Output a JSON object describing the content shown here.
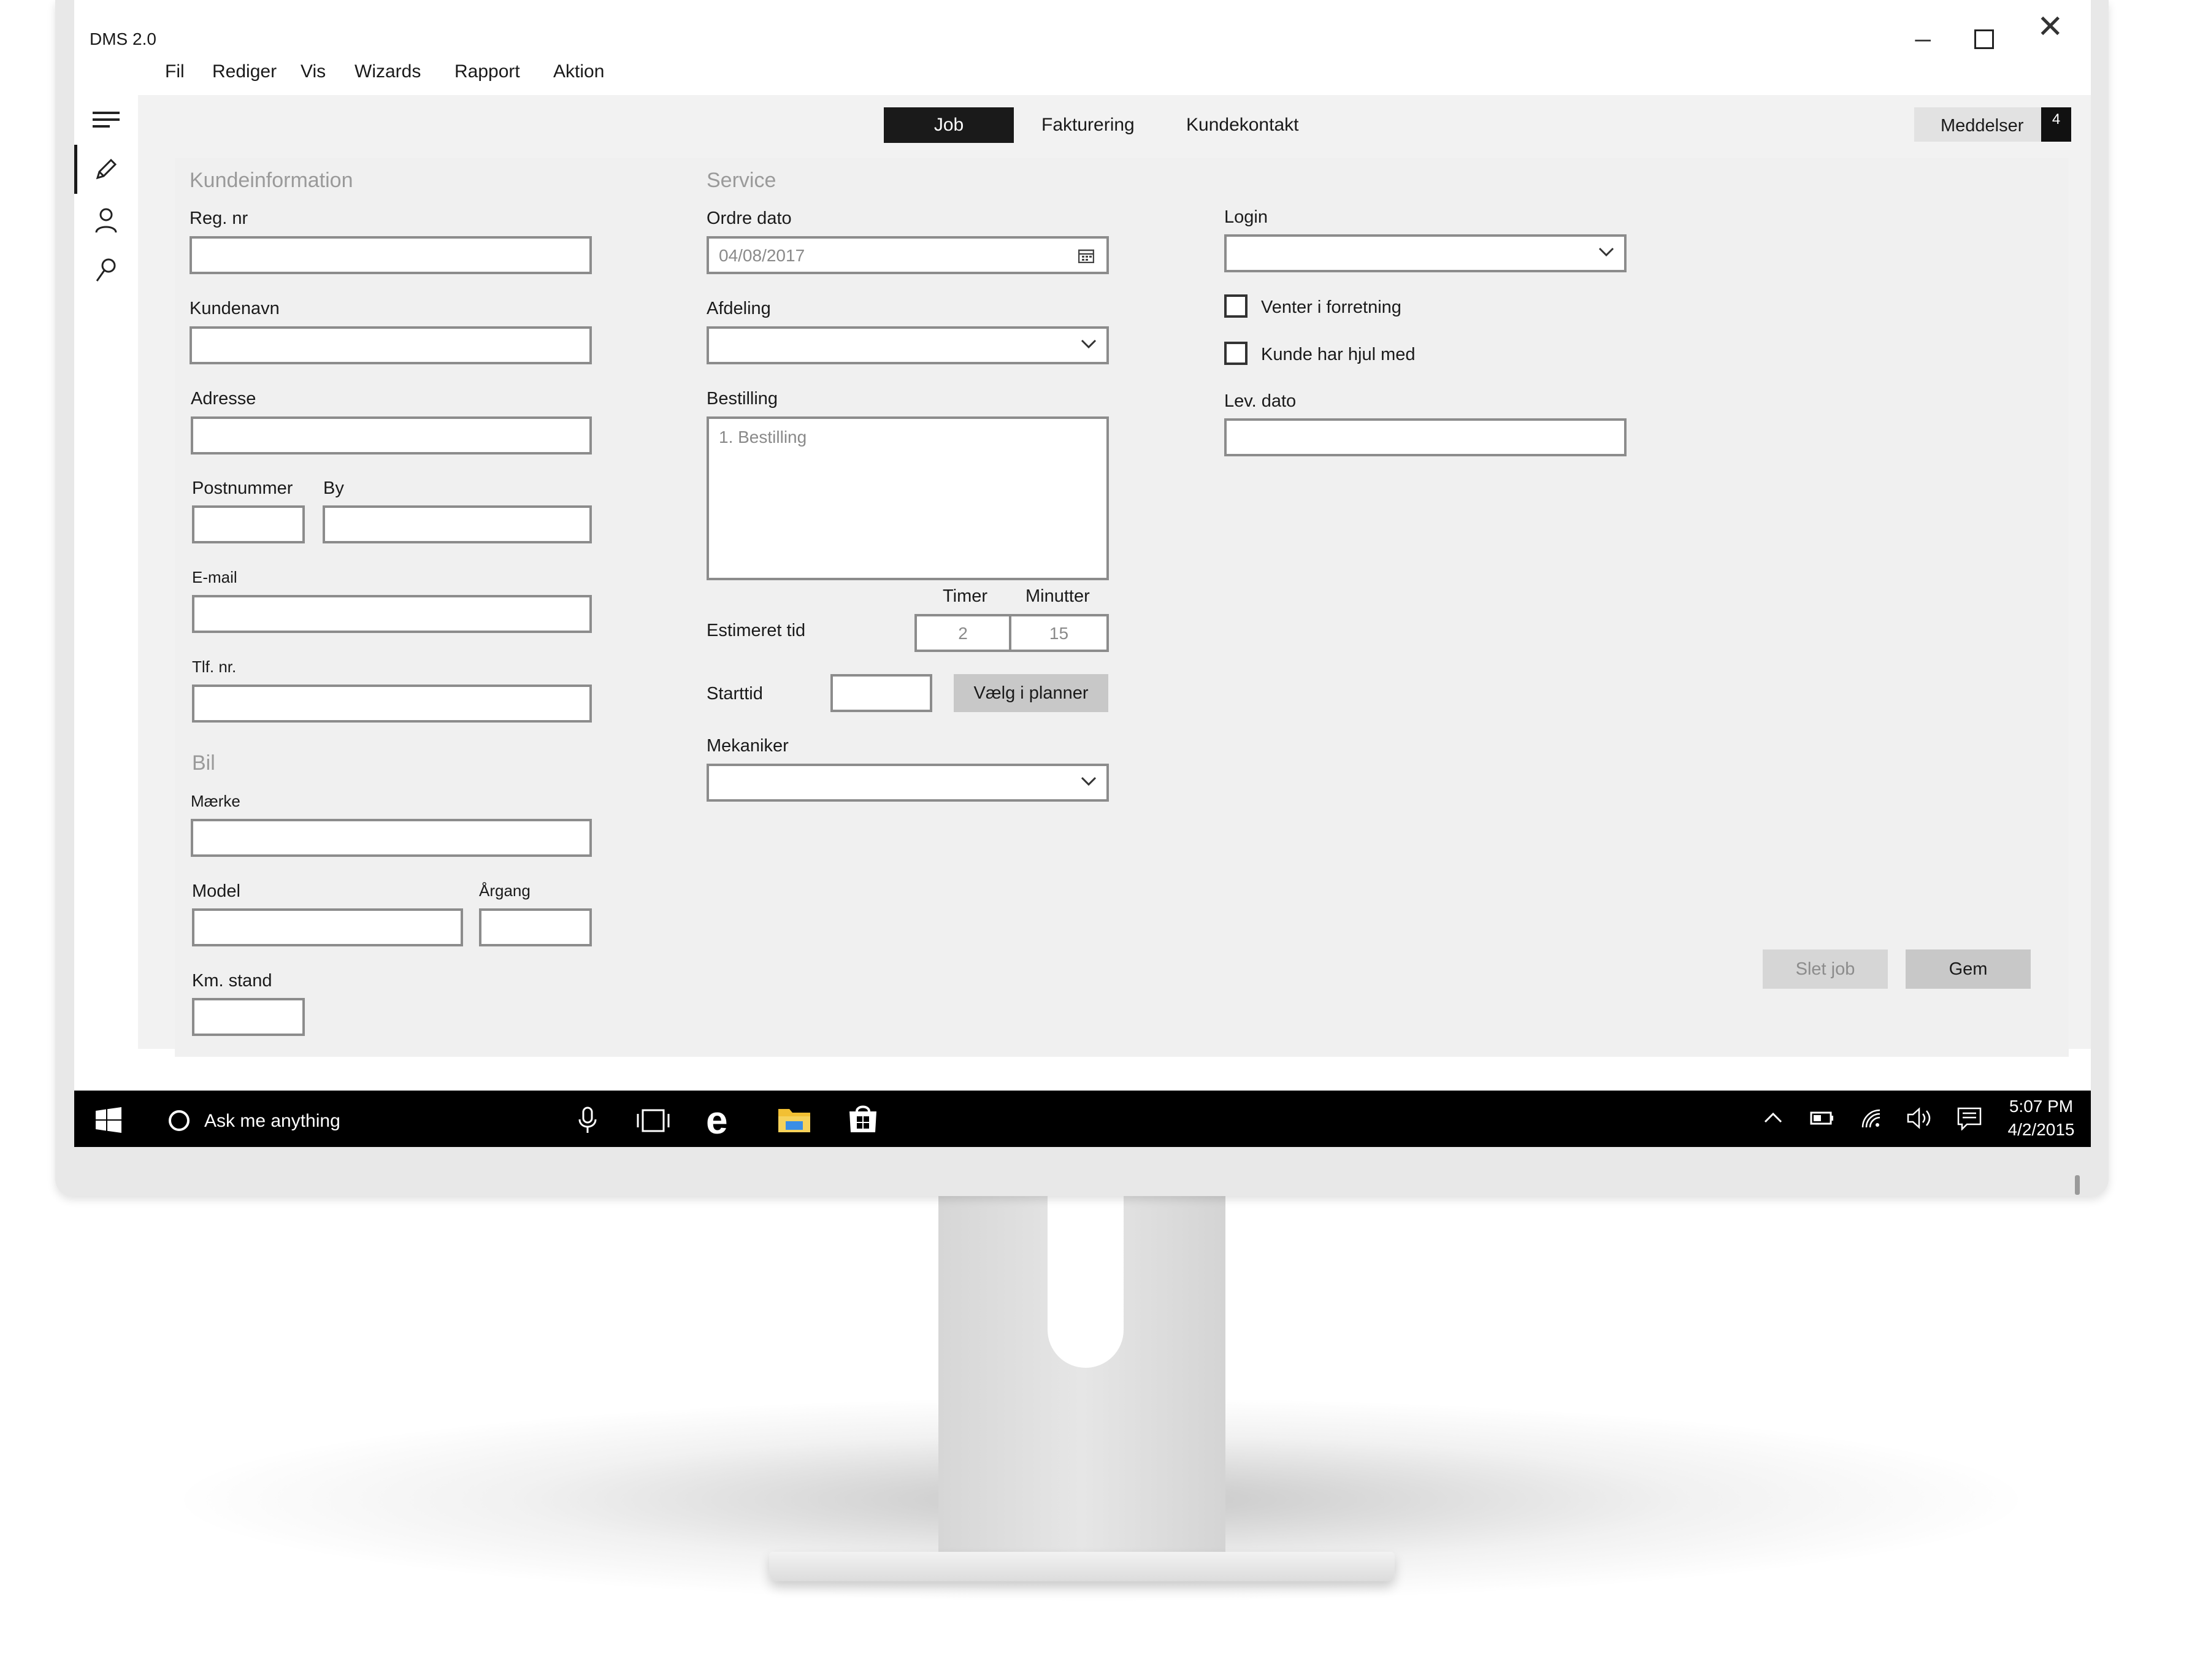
{
  "app": {
    "title": "DMS 2.0"
  },
  "menu": [
    "Fil",
    "Rediger",
    "Vis",
    "Wizards",
    "Rapport",
    "Aktion"
  ],
  "tabs": {
    "job": "Job",
    "fakturering": "Fakturering",
    "kundekontakt": "Kundekontakt"
  },
  "notifications": {
    "label": "Meddelser",
    "count": "4"
  },
  "kunde": {
    "title": "Kundeinformation",
    "reg_nr": "Reg. nr",
    "kundenavn": "Kundenavn",
    "adresse": "Adresse",
    "postnummer": "Postnummer",
    "by": "By",
    "email": "E-mail",
    "tlf": "Tlf. nr."
  },
  "bil": {
    "title": "Bil",
    "maerke": "Mærke",
    "model": "Model",
    "argang": "Årgang",
    "km_stand": "Km. stand"
  },
  "service": {
    "title": "Service",
    "ordre_dato": "Ordre dato",
    "ordre_dato_value": "04/08/2017",
    "afdeling": "Afdeling",
    "bestilling": "Bestilling",
    "bestilling_placeholder": "1. Bestilling",
    "timer": "Timer",
    "minutter": "Minutter",
    "estimeret_tid": "Estimeret tid",
    "timer_value": "2",
    "minutter_value": "15",
    "starttid": "Starttid",
    "vaelg_planner": "Vælg i planner",
    "mekaniker": "Mekaniker"
  },
  "right": {
    "login": "Login",
    "venter": "Venter i forretning",
    "hjul": "Kunde har hjul med",
    "lev_dato": "Lev. dato"
  },
  "actions": {
    "slet": "Slet job",
    "gem": "Gem"
  },
  "taskbar": {
    "search": "Ask me anything",
    "time": "5:07 PM",
    "date": "4/2/2015"
  },
  "icons": [
    "windows-logo-icon",
    "cortana-circle-icon",
    "microphone-icon",
    "task-view-icon",
    "edge-icon",
    "file-explorer-icon",
    "store-icon",
    "chevron-up-icon",
    "battery-icon",
    "wifi-icon",
    "volume-icon",
    "action-center-icon",
    "hamburger-icon",
    "pencil-icon",
    "user-icon",
    "search-icon",
    "calendar-icon",
    "chevron-down-icon"
  ]
}
